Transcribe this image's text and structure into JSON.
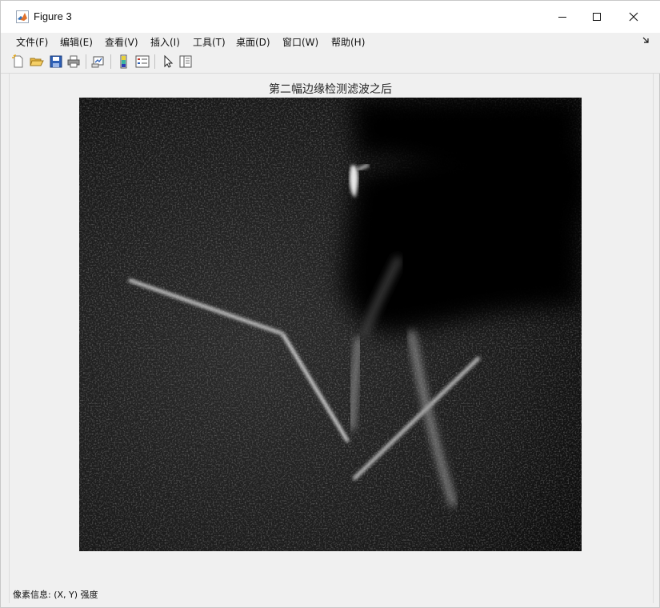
{
  "window": {
    "title": "Figure 3",
    "controls": {
      "minimize": "minimize",
      "maximize": "maximize",
      "close": "close"
    }
  },
  "menubar": {
    "items": [
      {
        "label": "文件(F)"
      },
      {
        "label": "编辑(E)"
      },
      {
        "label": "查看(V)"
      },
      {
        "label": "插入(I)"
      },
      {
        "label": "工具(T)"
      },
      {
        "label": "桌面(D)"
      },
      {
        "label": "窗口(W)"
      },
      {
        "label": "帮助(H)"
      }
    ],
    "dock_icon": "dock-arrow-icon"
  },
  "toolbar": {
    "buttons": [
      {
        "icon": "new-figure-icon"
      },
      {
        "icon": "open-file-icon"
      },
      {
        "icon": "save-icon"
      },
      {
        "icon": "print-icon"
      },
      {
        "icon": "link-plot-icon"
      },
      {
        "icon": "insert-colorbar-icon"
      },
      {
        "icon": "insert-legend-icon"
      },
      {
        "icon": "edit-plot-pointer-icon"
      },
      {
        "icon": "property-inspector-icon"
      }
    ]
  },
  "figure": {
    "axes_title": "第二幅边缘检测滤波之后",
    "image_description_tag": "edge-filtered-grayscale-image"
  },
  "statusbar": {
    "text": "像素信息: (X, Y)  强度"
  }
}
